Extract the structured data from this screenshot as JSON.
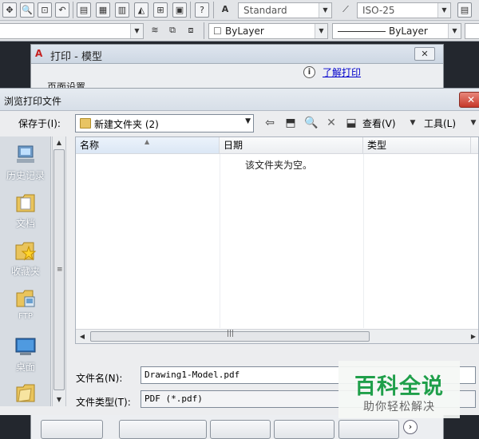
{
  "toolbar": {
    "text_style": "Standard",
    "dim_style": "ISO-25",
    "layer_color": "ByLayer",
    "linetype": "ByLayer"
  },
  "plot_dialog": {
    "title": "打印 - 模型",
    "learn_link": "了解打印",
    "page_setup": "页面设置"
  },
  "browse_dialog": {
    "title": "浏览打印文件",
    "save_in_label": "保存于(I):",
    "save_in_value": "新建文件夹 (2)",
    "view_label": "查看(V)",
    "tools_label": "工具(L)",
    "places": [
      {
        "label": "历史记录",
        "icon": "history-icon"
      },
      {
        "label": "文档",
        "icon": "documents-icon"
      },
      {
        "label": "收藏夹",
        "icon": "favorites-icon"
      },
      {
        "label": "FTP",
        "icon": "ftp-icon"
      },
      {
        "label": "桌面",
        "icon": "desktop-icon"
      }
    ],
    "columns": [
      "名称",
      "日期",
      "类型"
    ],
    "empty_message": "该文件夹为空。",
    "file_name_label": "文件名(N):",
    "file_name_value": "Drawing1-Model.pdf",
    "file_type_label": "文件类型(T):",
    "file_type_value": "PDF (*.pdf)"
  },
  "watermark": {
    "title": "百科全说",
    "subtitle": "助你轻松解决"
  },
  "colors": {
    "accent_link": "#0000cc",
    "close_button": "#c5382a",
    "watermark_green": "#1f9f4a"
  }
}
